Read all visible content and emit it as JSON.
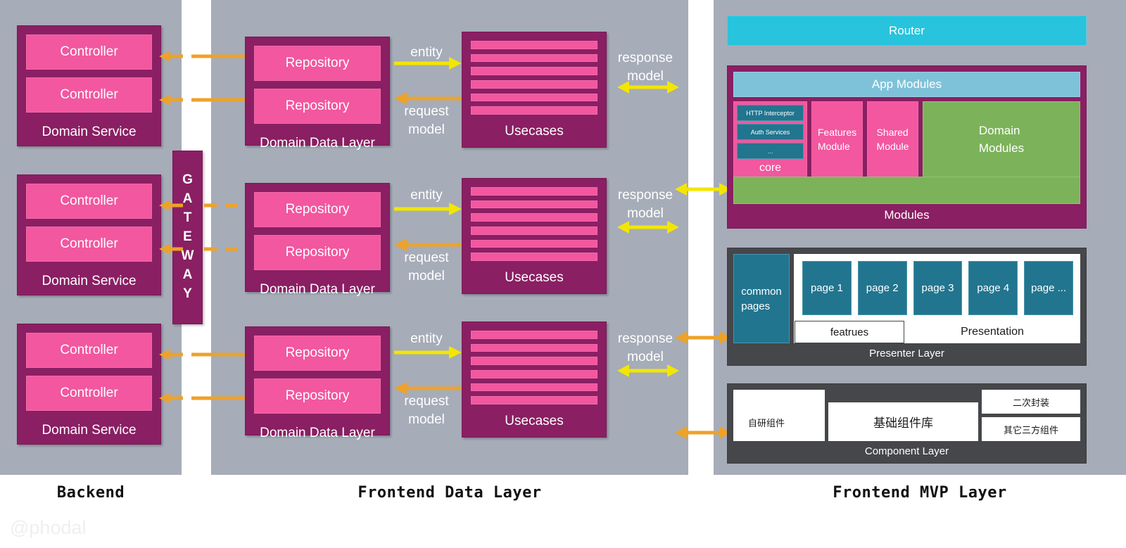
{
  "panels": {
    "backend": {
      "label": "Backend"
    },
    "data": {
      "label": "Frontend Data Layer"
    },
    "mvp": {
      "label": "Frontend MVP Layer"
    }
  },
  "watermark": "@phodal",
  "colors": {
    "panel_bg": "#a6acb8",
    "purple": "#8a1f63",
    "pink": "#f2579f",
    "teal": "#21758f",
    "cyan": "#28c3dc",
    "light_blue": "#7ec2d9",
    "green": "#7cb35a",
    "dark_grey": "#45474a",
    "arrow_yellow": "#f3e600",
    "arrow_orange": "#eda229"
  },
  "backend": {
    "services": [
      {
        "title": "Domain Service",
        "items": [
          "Controller",
          "Controller"
        ]
      },
      {
        "title": "Domain Service",
        "items": [
          "Controller",
          "Controller"
        ]
      },
      {
        "title": "Domain Service",
        "items": [
          "Controller",
          "Controller"
        ]
      }
    ]
  },
  "gateway": {
    "letters": [
      "G",
      "A",
      "T",
      "E",
      "W",
      "A",
      "Y"
    ]
  },
  "data_layer": {
    "repositories": [
      {
        "title": "Domain Data Layer",
        "items": [
          "Repository",
          "Repository"
        ]
      },
      {
        "title": "Domain Data Layer",
        "items": [
          "Repository",
          "Repository"
        ]
      },
      {
        "title": "Domain Data Layer",
        "items": [
          "Repository",
          "Repository"
        ]
      }
    ],
    "usecases": [
      {
        "title": "Usecases",
        "bars": 6
      },
      {
        "title": "Usecases",
        "bars": 6
      },
      {
        "title": "Usecases",
        "bars": 6
      }
    ],
    "arrow_labels": {
      "entity": "entity",
      "request_model": "request\nmodel",
      "response_model": "response\nmodel"
    }
  },
  "mvp": {
    "router": "Router",
    "modules": {
      "caption": "Modules",
      "app_modules": "App Modules",
      "core": {
        "label": "core",
        "items": [
          "HTTP Interceptor",
          "Auth Services",
          "..."
        ]
      },
      "features_module": "Features\nModule",
      "shared_module": "Shared\nModule",
      "domain_modules": "Domain\nModules"
    },
    "presenter": {
      "caption": "Presenter Layer",
      "common_pages": "common\npages",
      "pages": [
        "page 1",
        "page 2",
        "page 3",
        "page 4",
        "page ..."
      ],
      "featrues": "featrues",
      "presentation": "Presentation"
    },
    "component": {
      "caption": "Component Layer",
      "self_built": "自研组件",
      "base_library": "基础组件库",
      "wrapped": "二次封装",
      "third_party": "其它三方组件"
    }
  }
}
